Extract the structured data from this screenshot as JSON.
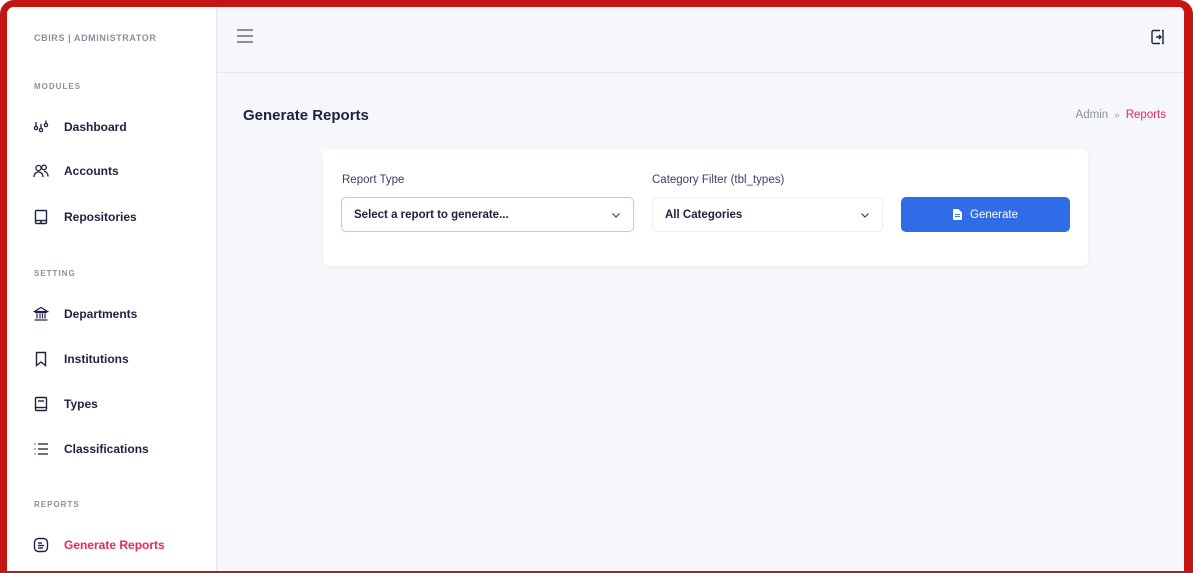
{
  "brand": "CBIRS | ADMINISTRATOR",
  "sidebar": {
    "sections": [
      {
        "label": "MODULES"
      },
      {
        "label": "SETTING"
      },
      {
        "label": "REPORTS"
      }
    ],
    "items": [
      {
        "label": "Dashboard",
        "icon": "dashboard-icon"
      },
      {
        "label": "Accounts",
        "icon": "users-icon"
      },
      {
        "label": "Repositories",
        "icon": "tablet-icon"
      },
      {
        "label": "Departments",
        "icon": "bank-icon"
      },
      {
        "label": "Institutions",
        "icon": "bookmark-icon"
      },
      {
        "label": "Types",
        "icon": "book-icon"
      },
      {
        "label": "Classifications",
        "icon": "list-icon"
      },
      {
        "label": "Generate Reports",
        "icon": "report-icon",
        "active": true
      }
    ]
  },
  "header": {
    "title": "Generate Reports",
    "breadcrumb": {
      "root": "Admin",
      "separator": "»",
      "current": "Reports"
    }
  },
  "form": {
    "report_type": {
      "label": "Report Type",
      "value": "Select a report to generate..."
    },
    "category_filter": {
      "label": "Category Filter (tbl_types)",
      "value": "All Categories"
    },
    "generate_button": "Generate"
  },
  "colors": {
    "accent": "#e8265a",
    "primary": "#2f6ce8",
    "frame": "#c41414"
  }
}
